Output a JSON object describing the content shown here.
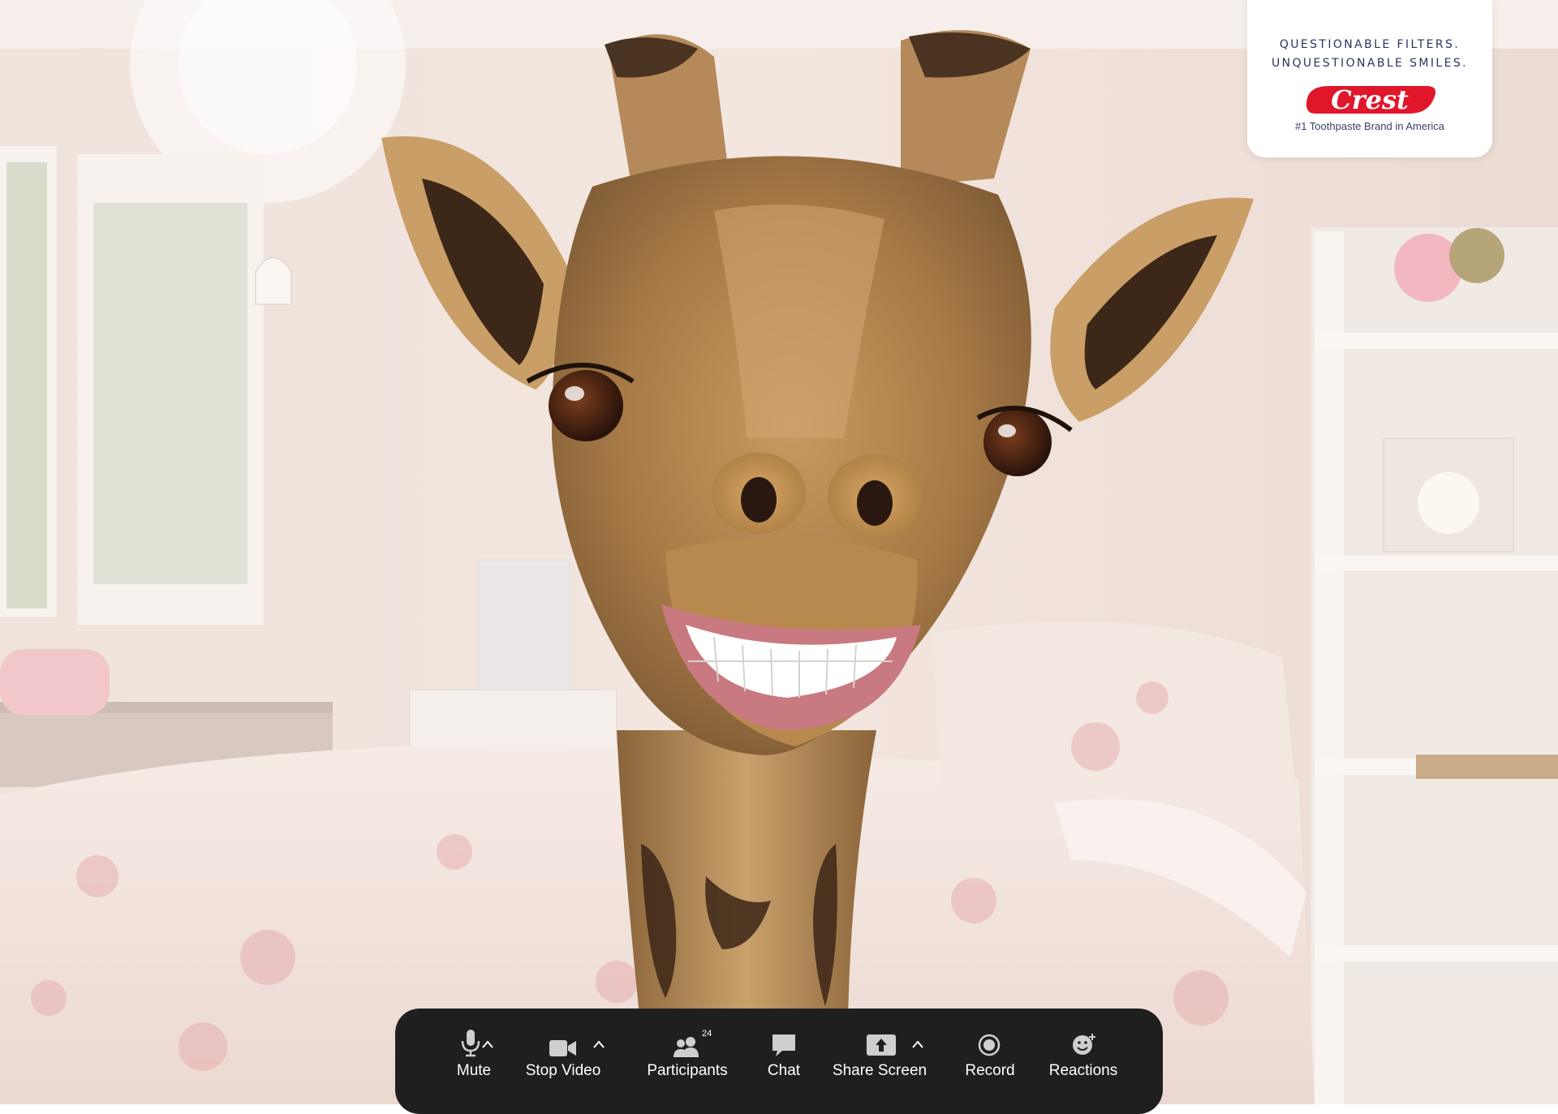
{
  "ad": {
    "tagline_line1": "QUESTIONABLE FILTERS.",
    "tagline_line2": "UNQUESTIONABLE SMILES.",
    "brand_name": "Crest",
    "brand_sub": "#1 Toothpaste Brand in America",
    "brand_color": "#e0162b"
  },
  "toolbar": {
    "background": "#1f1f1f",
    "items": [
      {
        "label": "Mute",
        "icon": "microphone-icon"
      },
      {
        "label": "Stop Video",
        "icon": "video-camera-icon"
      },
      {
        "label": "Participants",
        "icon": "participants-icon",
        "badge": "24"
      },
      {
        "label": "Chat",
        "icon": "chat-bubble-icon"
      },
      {
        "label": "Share Screen",
        "icon": "share-screen-icon"
      },
      {
        "label": "Record",
        "icon": "record-icon"
      },
      {
        "label": "Reactions",
        "icon": "reactions-icon"
      }
    ]
  }
}
